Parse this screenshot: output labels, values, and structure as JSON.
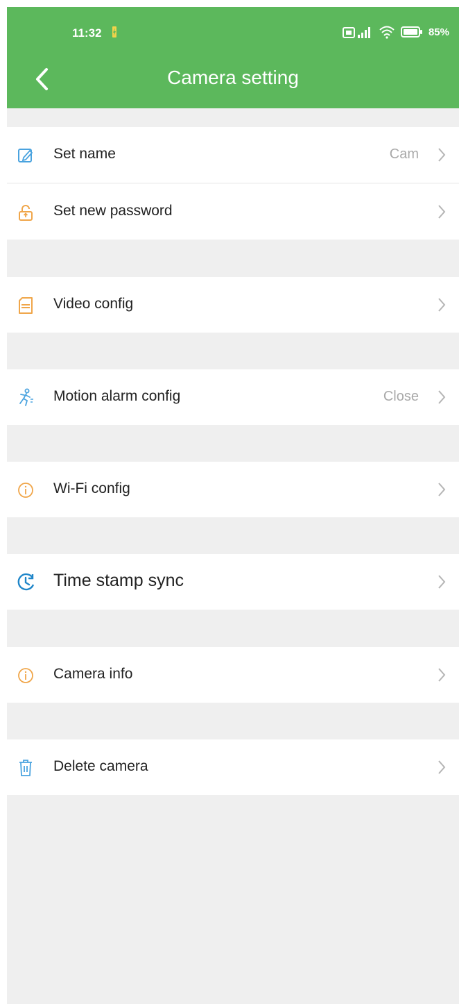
{
  "status_bar": {
    "time": "11:32",
    "battery": "85%"
  },
  "header": {
    "title": "Camera setting"
  },
  "rows": [
    {
      "label": "Set name",
      "value": "Cam",
      "icon": "edit-icon"
    },
    {
      "label": "Set new password",
      "value": "",
      "icon": "lock-icon"
    },
    {
      "label": "Video config",
      "value": "",
      "icon": "sd-card-icon"
    },
    {
      "label": "Motion alarm config",
      "value": "Close",
      "icon": "running-person-icon"
    },
    {
      "label": "Wi-Fi config",
      "value": "",
      "icon": "info-icon"
    },
    {
      "label": "Time stamp sync",
      "value": "",
      "icon": "clock-icon"
    },
    {
      "label": "Camera info",
      "value": "",
      "icon": "info-icon"
    },
    {
      "label": "Delete camera",
      "value": "",
      "icon": "trash-icon"
    }
  ],
  "colors": {
    "header": "#5cb85c",
    "background": "#efefef",
    "blue_icon": "#4aa3df",
    "orange_icon": "#f0a64a"
  }
}
